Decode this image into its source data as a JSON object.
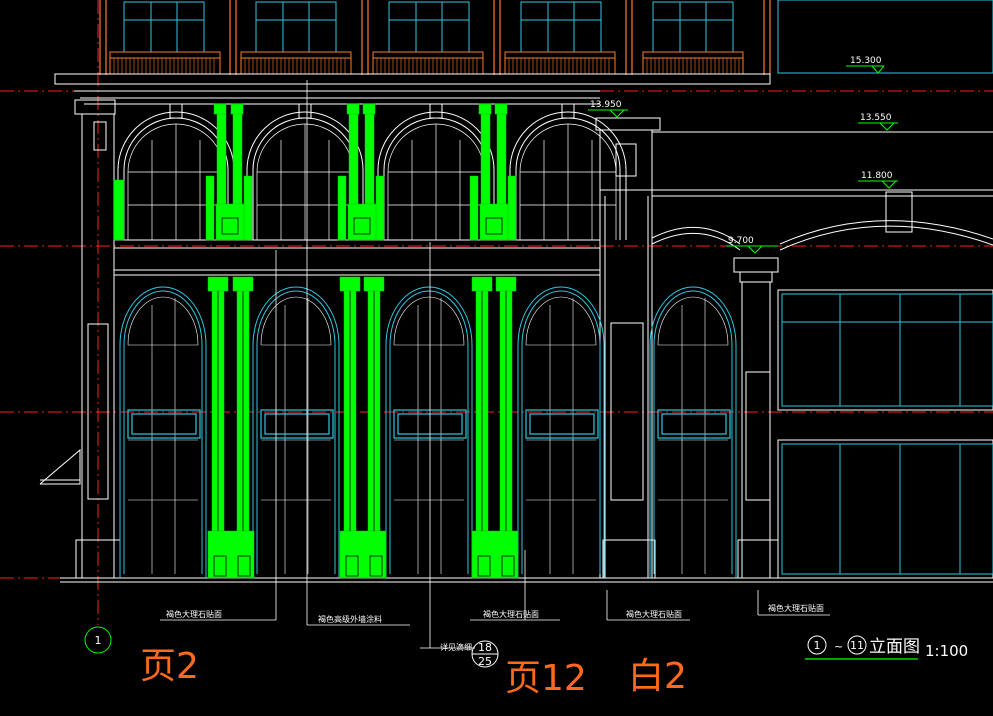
{
  "drawing": {
    "elevation_marks": [
      "15.300",
      "13.950",
      "13.550",
      "11.800",
      "9.700"
    ],
    "material_notes": [
      "褐色大理石贴面",
      "褐色高级外墙涂料",
      "褐色大理石贴面",
      "褐色大理石贴面",
      "褐色大理石贴面"
    ],
    "grid_axis": "1",
    "detail_ref": {
      "label": "详见滴细",
      "top": "18",
      "bottom": "25"
    },
    "title_block": {
      "from": "1",
      "to": "11",
      "title": "立面图",
      "scale": "1:100"
    }
  },
  "markup_annotations": [
    "页2",
    "页12",
    "白2"
  ],
  "colors": {
    "background": "#000000",
    "outline": "#ffffff",
    "accent_lines": "#ff7a2a",
    "glass_lines": "#2ec8e0",
    "column_fill": "#00ff00",
    "axis_line": "#ff2020",
    "handwriting": "#ff6a1a"
  }
}
